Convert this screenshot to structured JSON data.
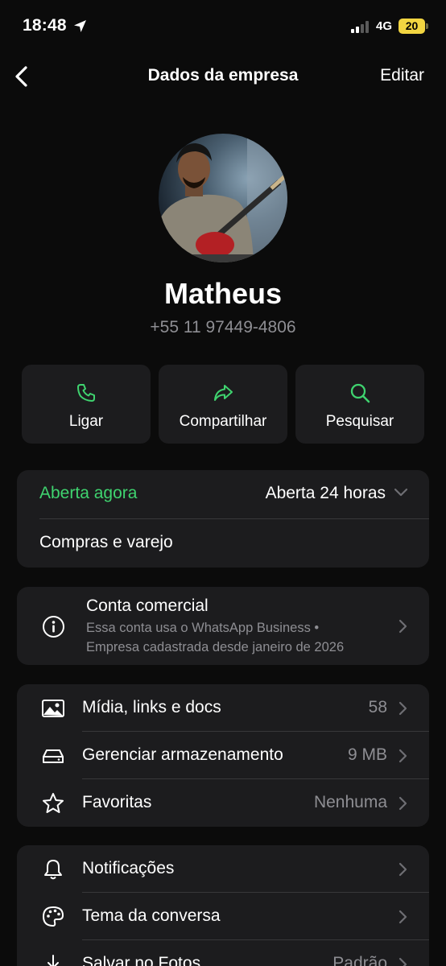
{
  "status_bar": {
    "time": "18:48",
    "network": "4G",
    "battery": "20"
  },
  "nav": {
    "title": "Dados da empresa",
    "edit_label": "Editar"
  },
  "profile": {
    "name": "Matheus",
    "phone": "+55 11 97449-4806"
  },
  "actions": [
    {
      "label": "Ligar",
      "icon": "phone-icon"
    },
    {
      "label": "Compartilhar",
      "icon": "share-icon"
    },
    {
      "label": "Pesquisar",
      "icon": "search-icon"
    }
  ],
  "hours": {
    "status": "Aberta agora",
    "schedule": "Aberta 24 horas",
    "category": "Compras e varejo"
  },
  "business": {
    "title": "Conta comercial",
    "line1": "Essa conta usa o WhatsApp Business •",
    "line2": "Empresa cadastrada desde janeiro de 2026"
  },
  "media_group": [
    {
      "label": "Mídia, links e docs",
      "value": "58",
      "icon": "image-icon"
    },
    {
      "label": "Gerenciar armazenamento",
      "value": "9 MB",
      "icon": "storage-icon"
    },
    {
      "label": "Favoritas",
      "value": "Nenhuma",
      "icon": "star-icon"
    }
  ],
  "settings_group": [
    {
      "label": "Notificações",
      "value": "",
      "icon": "bell-icon"
    },
    {
      "label": "Tema da conversa",
      "value": "",
      "icon": "palette-icon"
    },
    {
      "label": "Salvar no Fotos",
      "value": "Padrão",
      "icon": "download-icon"
    }
  ],
  "colors": {
    "accent_green": "#3fd36f",
    "card_bg": "#1c1c1e",
    "background": "#0b0b0b",
    "battery": "#f2d541"
  }
}
